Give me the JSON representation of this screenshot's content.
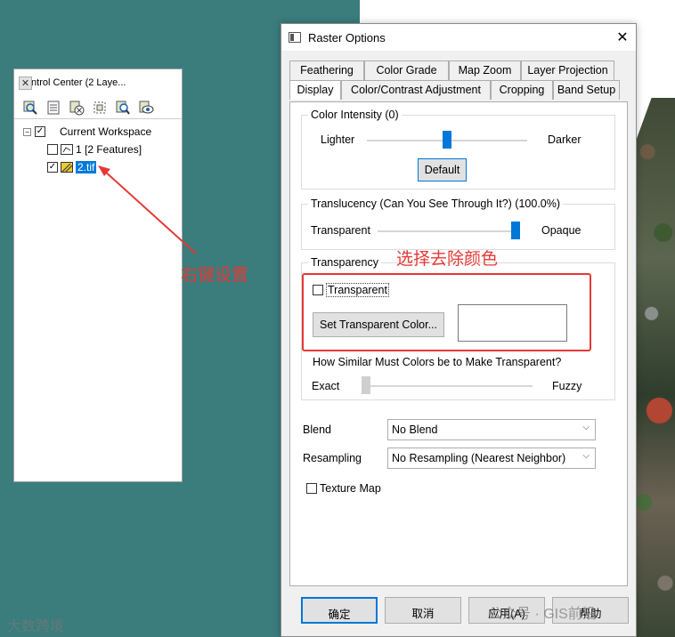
{
  "control_center": {
    "title": "Control Center (2 Laye...",
    "toolbar_icons": [
      "zoom-layer-icon",
      "layer-list-icon",
      "remove-layer-icon",
      "select-icon",
      "search-icon",
      "view-icon"
    ],
    "tree": {
      "root_label": "Current Workspace",
      "items": [
        {
          "label": "1 [2 Features]",
          "checked": false
        },
        {
          "label": "2.tif",
          "checked": true,
          "selected": true
        }
      ]
    }
  },
  "dialog": {
    "title": "Raster Options",
    "tabs_row1": [
      "Feathering",
      "Color Grade",
      "Map Zoom",
      "Layer Projection"
    ],
    "tabs_row2": [
      "Display",
      "Color/Contrast Adjustment",
      "Cropping",
      "Band Setup"
    ],
    "active_tab": "Display",
    "color_intensity": {
      "title": "Color Intensity (0)",
      "left_label": "Lighter",
      "right_label": "Darker",
      "value": 0.5,
      "default_button": "Default"
    },
    "translucency": {
      "title": "Translucency (Can You See Through It?) (100.0%)",
      "left_label": "Transparent",
      "right_label": "Opaque",
      "value": 1.0
    },
    "transparency": {
      "title": "Transparency",
      "checkbox_label": "Transparent",
      "checked": false,
      "set_color_button": "Set Transparent Color...",
      "swatch_color": "#ffffff",
      "similarity_title": "How Similar Must Colors be to Make Transparent?",
      "left_label": "Exact",
      "right_label": "Fuzzy",
      "value": 0.0
    },
    "blend": {
      "label": "Blend",
      "value": "No Blend"
    },
    "resampling": {
      "label": "Resampling",
      "value": "No Resampling (Nearest Neighbor)"
    },
    "texture_map": {
      "label": "Texture Map",
      "checked": false
    },
    "buttons": {
      "ok": "确定",
      "cancel": "取消",
      "apply": "应用(A)",
      "help": "帮助"
    }
  },
  "annotations": {
    "right_click_note": "右键设置",
    "select_color_note": "选择去除颜色",
    "accent_color": "#e53935"
  },
  "watermarks": {
    "bottom_left": "大数跨境",
    "bottom_right": "公众号 · GIS前沿"
  }
}
